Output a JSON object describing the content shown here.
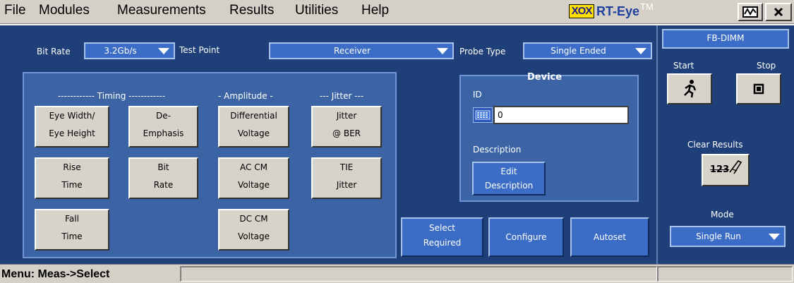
{
  "menu": {
    "items": [
      "File",
      "Modules",
      "Measurements",
      "Results",
      "Utilities",
      "Help"
    ]
  },
  "app": {
    "logo": "XOX",
    "title": "RT-Eye",
    "tm": "TM",
    "title_buttons": [
      "scope-icon",
      "close-icon"
    ]
  },
  "settings": {
    "bit_rate_label": "Bit Rate",
    "bit_rate_value": "3.2Gb/s",
    "test_point_label": "Test Point",
    "test_point_value": "Receiver",
    "probe_type_label": "Probe Type",
    "probe_type_value": "Single Ended"
  },
  "measurements": {
    "timing_header": "------------ Timing ------------",
    "amplitude_header": "- Amplitude -",
    "jitter_header": "--- Jitter ---",
    "eye_width_l1": "Eye Width/",
    "eye_width_l2": "Eye Height",
    "de_emphasis_l1": "De-",
    "de_emphasis_l2": "Emphasis",
    "differential_l1": "Differential",
    "differential_l2": "Voltage",
    "jitter_ber_l1": "Jitter",
    "jitter_ber_l2": "@ BER",
    "rise_l1": "Rise",
    "rise_l2": "Time",
    "bit_rate_l1": "Bit",
    "bit_rate_l2": "Rate",
    "ac_cm_l1": "AC CM",
    "ac_cm_l2": "Voltage",
    "tie_l1": "TIE",
    "tie_l2": "Jitter",
    "fall_l1": "Fall",
    "fall_l2": "Time",
    "dc_cm_l1": "DC CM",
    "dc_cm_l2": "Voltage"
  },
  "device": {
    "title": "Device",
    "id_label": "ID",
    "id_value": "0",
    "description_label": "Description",
    "edit_l1": "Edit",
    "edit_l2": "Description"
  },
  "actions": {
    "select_required_l1": "Select",
    "select_required_l2": "Required",
    "configure": "Configure",
    "autoset": "Autoset"
  },
  "right_panel": {
    "module": "FB-DIMM",
    "start": "Start",
    "stop": "Stop",
    "clear_results": "Clear Results",
    "clear_icon_text": "123",
    "mode_label": "Mode",
    "mode_value": "Single Run"
  },
  "status": {
    "text": "Menu: Meas->Select"
  },
  "colors": {
    "panel_bg": "#1f3f78",
    "group_bg": "#3c64a5",
    "dropdown_bg": "#3b6cc6",
    "button_gray": "#d7d3cb",
    "menu_bg": "#d4d0c8",
    "logo_yellow": "#ffe000"
  }
}
